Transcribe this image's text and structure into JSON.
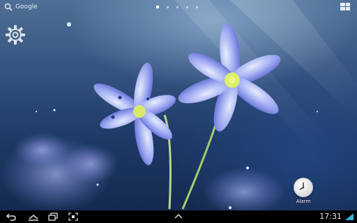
{
  "search": {
    "label": "Google"
  },
  "home_pages": {
    "count": 5,
    "active_index": 0
  },
  "widgets": {
    "alarm_label": "Alarm"
  },
  "status_bar": {
    "time": "17:31"
  },
  "icons": {
    "search": "search-icon",
    "apps": "apps-grid-icon",
    "settings": "gear-icon",
    "alarm": "alarm-clock-icon",
    "back": "back-icon",
    "home": "home-icon",
    "recent": "recent-apps-icon",
    "screenshot": "screenshot-icon",
    "up": "chevron-up-icon",
    "signal": "signal-icon"
  }
}
